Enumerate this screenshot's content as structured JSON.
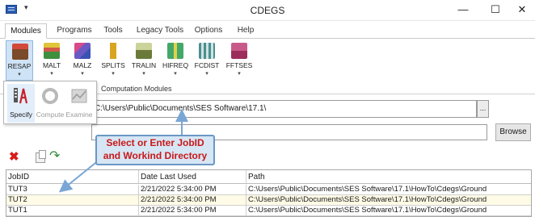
{
  "window": {
    "title": "CDEGS",
    "quick_access_symbol": "▾",
    "minimize_symbol": "—",
    "maximize_symbol": "☐",
    "close_symbol": "✕"
  },
  "tabs": [
    {
      "label": "Modules",
      "active": true
    },
    {
      "label": "Programs",
      "active": false
    },
    {
      "label": "Tools",
      "active": false
    },
    {
      "label": "Legacy Tools",
      "active": false
    },
    {
      "label": "Options",
      "active": false
    },
    {
      "label": "Help",
      "active": false
    }
  ],
  "ribbon": {
    "group_label": "Computation Modules",
    "caret": "▾",
    "buttons": [
      {
        "label": "RESAP",
        "icon": "resap-icon",
        "color": "#7a4a2a",
        "selected": true
      },
      {
        "label": "MALT",
        "icon": "malt-icon",
        "color": "#3f8f3f"
      },
      {
        "label": "MALZ",
        "icon": "malz-icon",
        "color": "#3a52b4"
      },
      {
        "label": "SPLITS",
        "icon": "splits-icon",
        "color": "#d9a520"
      },
      {
        "label": "TRALIN",
        "icon": "tralin-icon",
        "color": "#6b7a3a"
      },
      {
        "label": "HIFREQ",
        "icon": "hifreq-icon",
        "color": "#44a86a"
      },
      {
        "label": "FCDIST",
        "icon": "fcdist-icon",
        "color": "#4c8f8f"
      },
      {
        "label": "FFTSES",
        "icon": "fftses-icon",
        "color": "#9c2c5c"
      }
    ]
  },
  "dropdown": {
    "items": [
      {
        "label": "Specify",
        "icon": "specify-icon",
        "enabled": true
      },
      {
        "label": "Compute",
        "icon": "compute-icon",
        "enabled": false
      },
      {
        "label": "Examine",
        "icon": "examine-icon",
        "enabled": false
      }
    ]
  },
  "paths": {
    "working_directory": "C:\\Users\\Public\\Documents\\SES Software\\17.1\\",
    "ellipsis_label": "...",
    "jobid_value": "",
    "browse_label": "Browse"
  },
  "toolbar": {
    "delete_symbol": "✖",
    "refresh_symbol": "↷"
  },
  "callout": {
    "line1": "Select or Enter JobID",
    "line2": "and Workind Directory"
  },
  "table": {
    "headers": [
      "JobID",
      "Date Last Used",
      "Path"
    ],
    "rows": [
      {
        "jobid": "TUT3",
        "date": "2/21/2022 5:34:00 PM",
        "path": "C:\\Users\\Public\\Documents\\SES Software\\17.1\\HowTo\\Cdegs\\Ground",
        "selected": false
      },
      {
        "jobid": "TUT2",
        "date": "2/21/2022 5:34:00 PM",
        "path": "C:\\Users\\Public\\Documents\\SES Software\\17.1\\HowTo\\Cdegs\\Ground",
        "selected": true
      },
      {
        "jobid": "TUT1",
        "date": "2/21/2022 5:34:00 PM",
        "path": "C:\\Users\\Public\\Documents\\SES Software\\17.1\\HowTo\\Cdegs\\Ground",
        "selected": false
      }
    ]
  }
}
